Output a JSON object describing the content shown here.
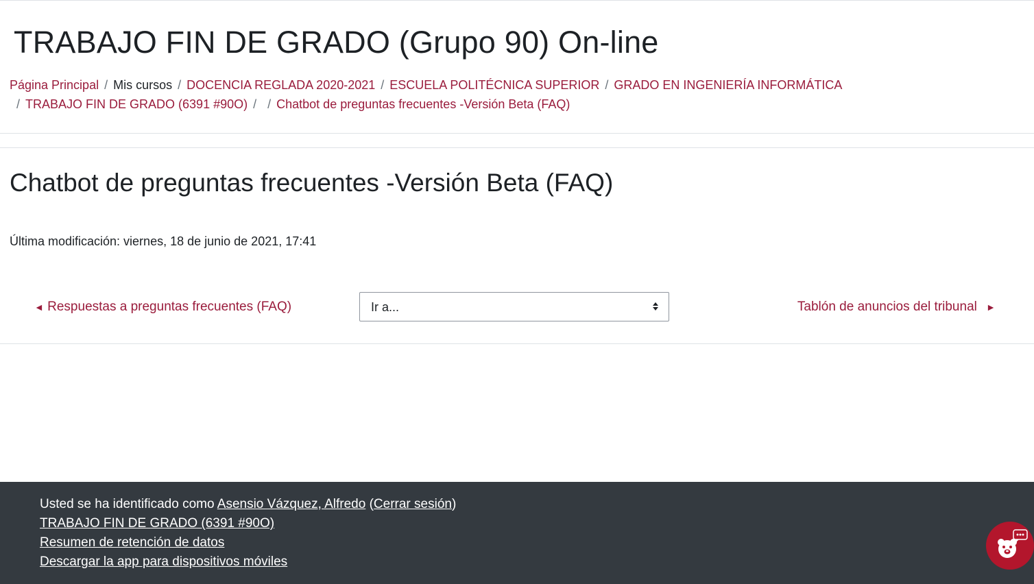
{
  "course": {
    "title": "TRABAJO FIN DE GRADO (Grupo 90) On-line"
  },
  "breadcrumb": {
    "items": [
      {
        "label": "Página Principal",
        "link": true
      },
      {
        "label": "Mis cursos",
        "link": false
      },
      {
        "label": "DOCENCIA REGLADA 2020-2021",
        "link": true
      },
      {
        "label": "ESCUELA POLITÉCNICA SUPERIOR",
        "link": true
      },
      {
        "label": "GRADO EN INGENIERÍA INFORMÁTICA",
        "link": true
      },
      {
        "label": "TRABAJO FIN DE GRADO (6391 #90O)",
        "link": true
      },
      {
        "label": "",
        "link": false
      },
      {
        "label": "Chatbot de preguntas frecuentes -Versión Beta (FAQ)",
        "link": true
      }
    ],
    "separator": "/"
  },
  "page": {
    "heading": "Chatbot de preguntas frecuentes -Versión Beta (FAQ)",
    "last_modified": "Última modificación: viernes, 18 de junio de 2021, 17:41"
  },
  "navigation": {
    "prev_label": "Respuestas a preguntas frecuentes (FAQ)",
    "prev_arrow": "◄",
    "jump_placeholder": "Ir a...",
    "next_label": "Tablón de anuncios del tribunal",
    "next_arrow": "►"
  },
  "footer": {
    "logged_in_prefix": "Usted se ha identificado como",
    "user_name": "Asensio Vázquez, Alfredo",
    "open_paren": "(",
    "logout_label": "Cerrar sesión",
    "close_paren": ")",
    "course_link": "TRABAJO FIN DE GRADO (6391 #90O)",
    "data_retention_link": "Resumen de retención de datos",
    "mobile_app_link": "Descargar la app para dispositivos móviles"
  },
  "colors": {
    "link": "#9a1c3c",
    "footer_bg": "#343a40",
    "chat_bubble": "#b3162c"
  },
  "icons": {
    "prev": "left-arrow-icon",
    "next": "right-arrow-icon",
    "select": "select-caret-icon",
    "chat": "chatbot-bear-icon"
  }
}
